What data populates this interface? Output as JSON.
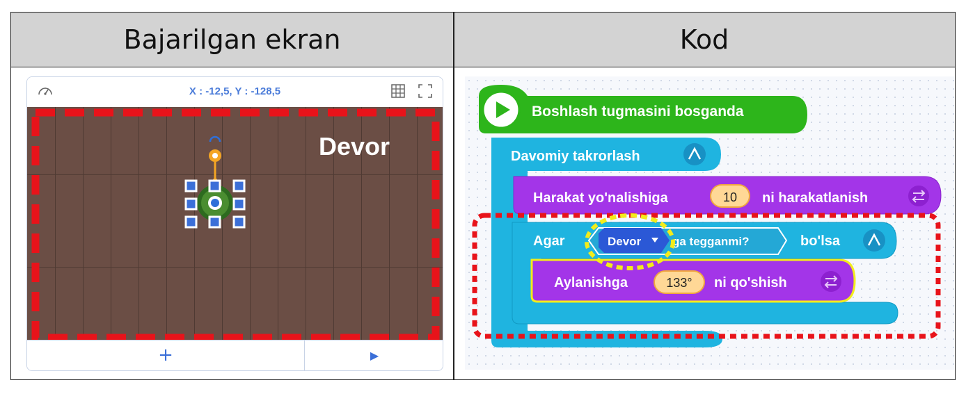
{
  "headers": {
    "left": "Bajarilgan ekran",
    "right": "Kod"
  },
  "stage": {
    "coord_text": "X : -12,5, Y : -128,5",
    "wall_label": "Devor",
    "add_button": "+",
    "play_button": "▶",
    "icons": [
      "speedometer-icon",
      "grid-icon",
      "fullscreen-icon",
      "rotate-icon"
    ]
  },
  "code": {
    "start_block": "Boshlash tugmasini bosganda",
    "loop_block": "Davomiy takrorlash",
    "move_block": {
      "prefix": "Harakat yo'nalishiga",
      "value": "10",
      "suffix": "ni harakatlanish"
    },
    "if_block": {
      "prefix": "Agar",
      "sensor_object": "Devor",
      "sensor_suffix": "ga tegganmi?",
      "suffix": "bo'lsa"
    },
    "rotate_block": {
      "prefix": "Aylanishga",
      "value": "133°",
      "suffix": "ni qo'shish"
    }
  },
  "colors": {
    "start": "#2db51b",
    "loop": "#1fb4e0",
    "motion": "#a335e8",
    "sensor": "#2b58d6",
    "highlight_red": "#e8131a",
    "highlight_yellow": "#f3ec1b"
  }
}
